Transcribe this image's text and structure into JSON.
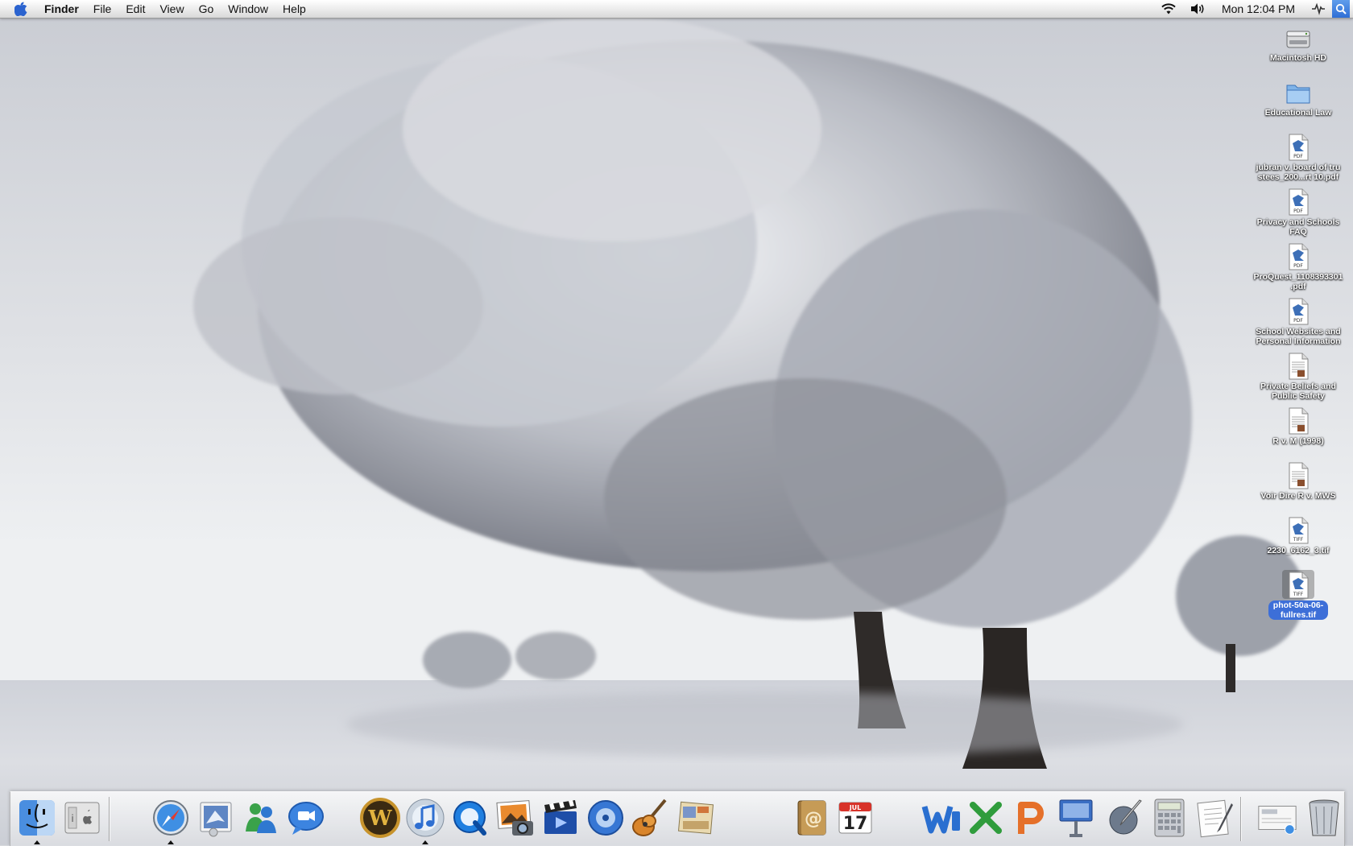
{
  "menubar": {
    "app_name": "Finder",
    "menus": [
      "File",
      "Edit",
      "View",
      "Go",
      "Window",
      "Help"
    ],
    "clock": "Mon 12:04 PM",
    "extras": [
      "wifi-icon",
      "volume-icon",
      "sync-icon",
      "spotlight-icon"
    ]
  },
  "desktop": {
    "icons": [
      {
        "label": "Macintosh HD",
        "icon": "hard-drive-icon",
        "badge": ""
      },
      {
        "label": "Educational Law",
        "icon": "folder-icon",
        "badge": ""
      },
      {
        "label": "jubran v. board of tru\nstees_200...rt 10.pdf",
        "icon": "pdf-document-icon",
        "badge": "PDF"
      },
      {
        "label": "Privacy and Schools\nFAQ",
        "icon": "pdf-document-icon",
        "badge": "PDF"
      },
      {
        "label": "ProQuest_1108393301\n.pdf",
        "icon": "pdf-document-icon",
        "badge": "PDF"
      },
      {
        "label": "School Websites and\nPersonal Information",
        "icon": "pdf-document-icon",
        "badge": "PDF"
      },
      {
        "label": "Private Beliefs and\nPublic Safety",
        "icon": "text-document-icon",
        "badge": ""
      },
      {
        "label": "R v. M (1998)",
        "icon": "text-document-icon",
        "badge": ""
      },
      {
        "label": "Voir Dire R v. MWS",
        "icon": "text-document-icon",
        "badge": ""
      },
      {
        "label": "2230_6162_3.tif",
        "icon": "tiff-document-icon",
        "badge": "TIFF"
      },
      {
        "label": "phot-50a-06-\nfullres.tif",
        "icon": "tiff-document-icon",
        "badge": "TIFF",
        "selected": true
      }
    ]
  },
  "dock": {
    "items": [
      {
        "name": "finder",
        "running": true
      },
      {
        "name": "system-profiler",
        "running": false
      },
      {
        "name": "safari",
        "running": true
      },
      {
        "name": "mail",
        "running": false
      },
      {
        "name": "messenger",
        "running": false
      },
      {
        "name": "ichat",
        "running": false
      },
      {
        "name": "world-of-warcraft",
        "running": false
      },
      {
        "name": "itunes",
        "running": true
      },
      {
        "name": "quicktime",
        "running": false
      },
      {
        "name": "iphoto",
        "running": false
      },
      {
        "name": "imovie",
        "running": false
      },
      {
        "name": "idvd",
        "running": false
      },
      {
        "name": "garageband",
        "running": false
      },
      {
        "name": "iweb",
        "running": false
      },
      {
        "name": "address-book",
        "running": false
      },
      {
        "name": "ical",
        "running": false
      },
      {
        "name": "microsoft-word",
        "running": false
      },
      {
        "name": "microsoft-excel",
        "running": false
      },
      {
        "name": "microsoft-powerpoint",
        "running": false
      },
      {
        "name": "keynote",
        "running": false
      },
      {
        "name": "script-editor",
        "running": false
      },
      {
        "name": "calculator",
        "running": false
      },
      {
        "name": "textedit",
        "running": false
      },
      {
        "name": "documents-stack",
        "running": false
      },
      {
        "name": "trash",
        "running": false
      }
    ],
    "ical_date": "17",
    "ical_month": "JUL"
  }
}
